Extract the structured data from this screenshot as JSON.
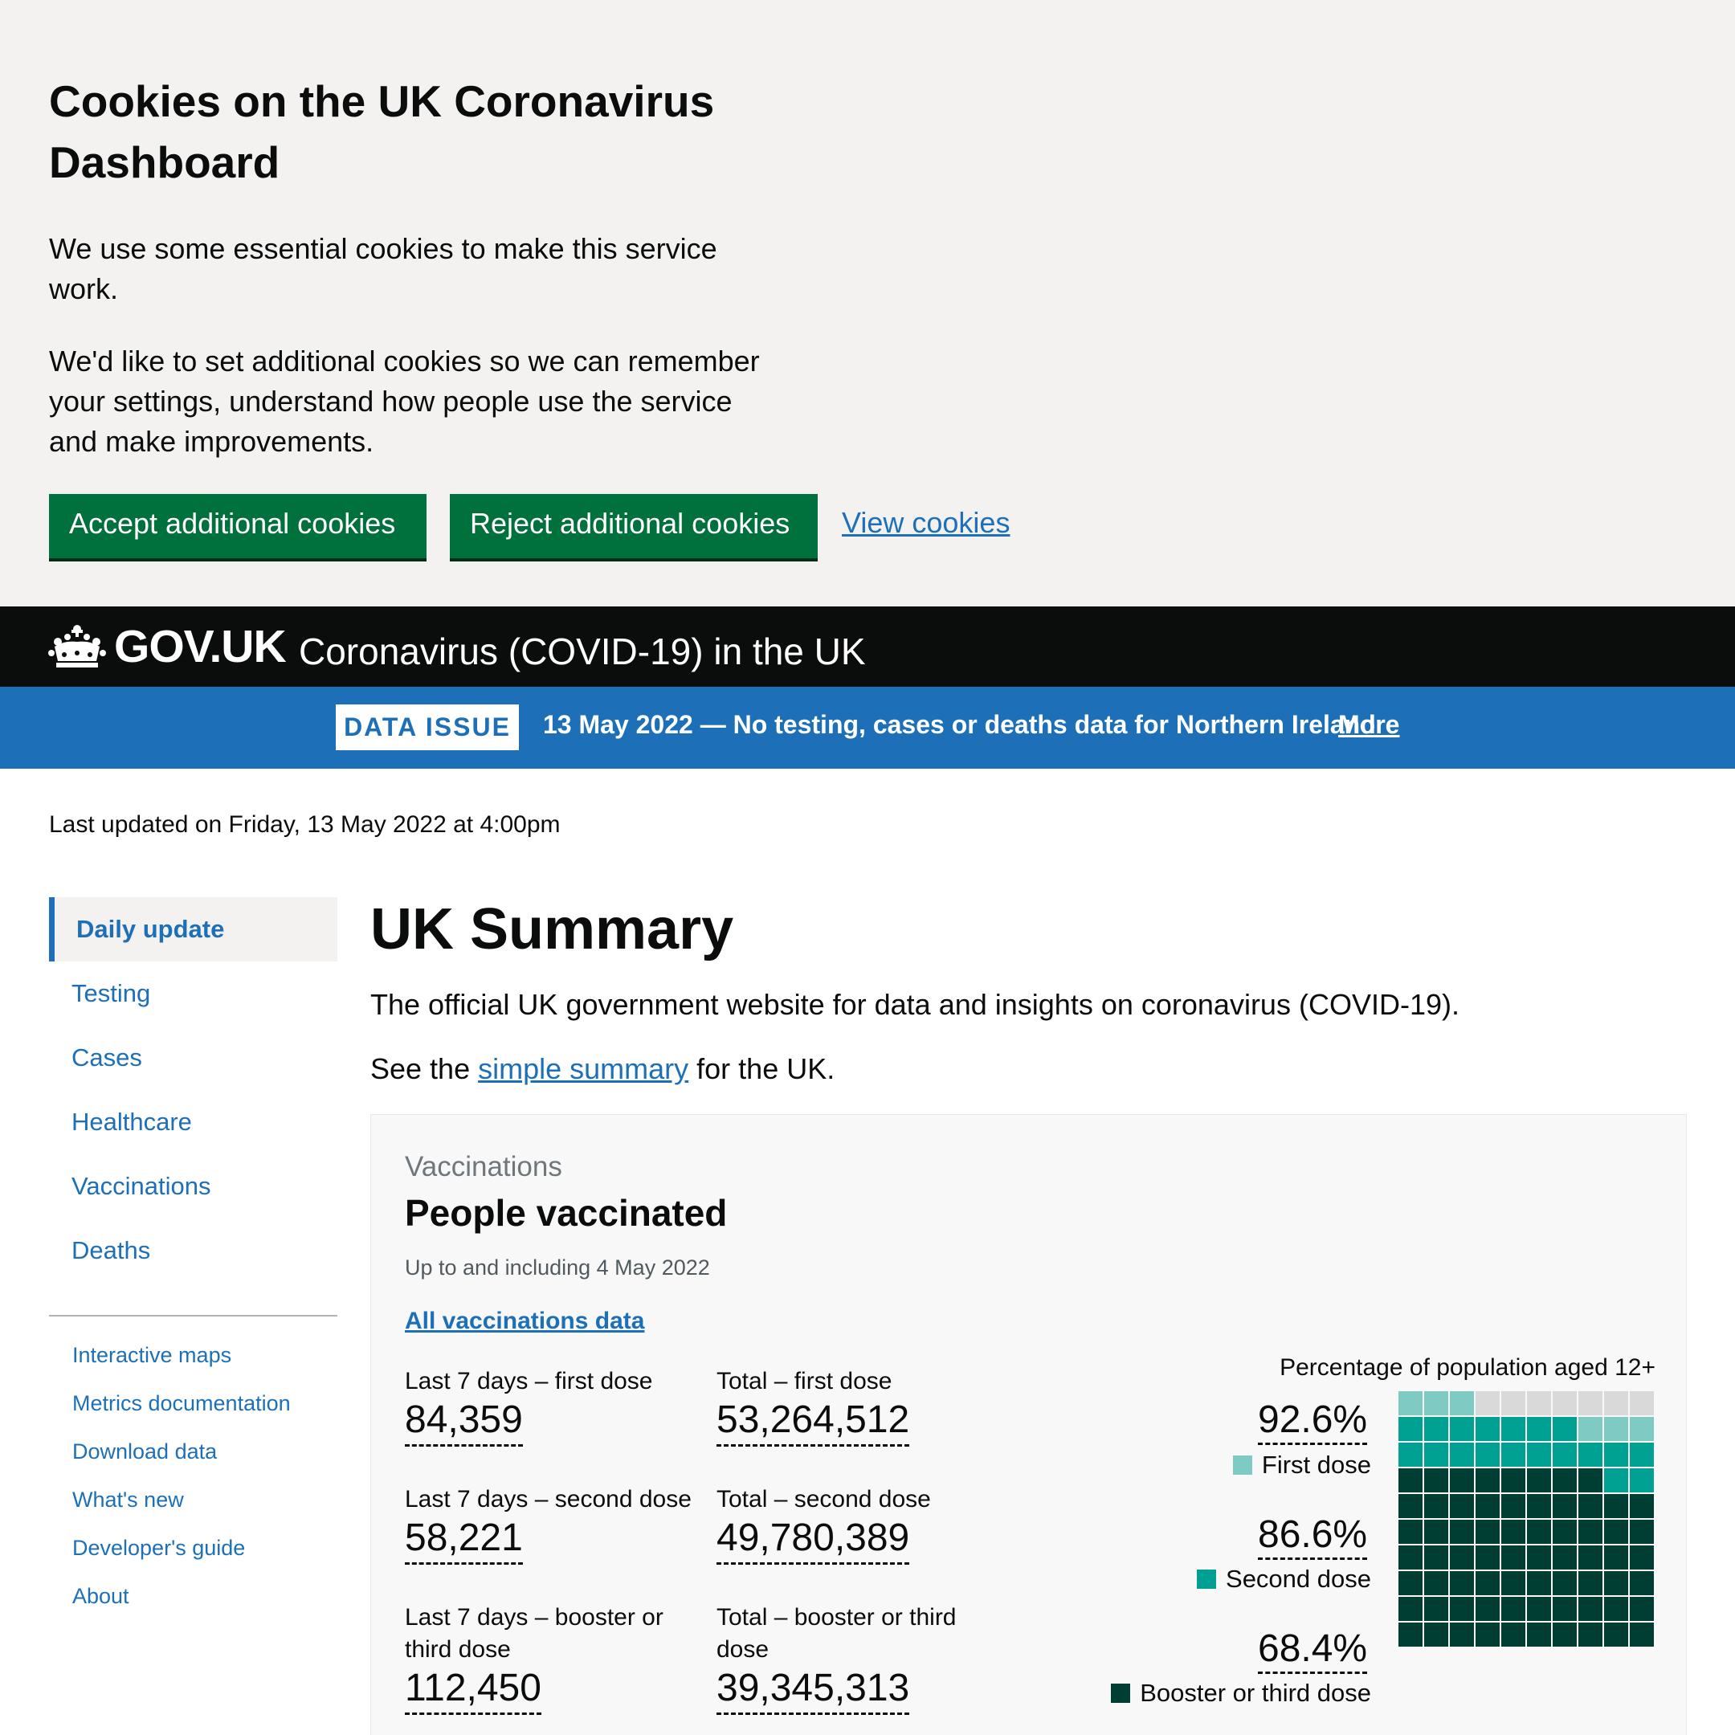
{
  "cookie_banner": {
    "title": "Cookies on the UK Coronavirus Dashboard",
    "paragraph_1": "We use some essential cookies to make this service work.",
    "paragraph_2": "We'd like to set additional cookies so we can remember your settings, understand how people use the service and make improvements.",
    "accept_label": "Accept additional cookies",
    "reject_label": "Reject additional cookies",
    "view_label": "View cookies"
  },
  "header": {
    "brand": "GOV.UK",
    "service_name": "Coronavirus (COVID-19) in the UK"
  },
  "data_issue": {
    "tag": "DATA ISSUE",
    "text": "13 May 2022 — No testing, cases or deaths data for Northern Ireland",
    "more_label": "More"
  },
  "last_updated": "Last updated on Friday, 13 May 2022 at 4:00pm",
  "sidenav": {
    "items": [
      {
        "label": "Daily update",
        "active": true
      },
      {
        "label": "Testing"
      },
      {
        "label": "Cases"
      },
      {
        "label": "Healthcare"
      },
      {
        "label": "Vaccinations"
      },
      {
        "label": "Deaths"
      }
    ],
    "secondary": [
      {
        "label": "Interactive maps"
      },
      {
        "label": "Metrics documentation"
      },
      {
        "label": "Download data"
      },
      {
        "label": "What's new"
      },
      {
        "label": "Developer's guide"
      },
      {
        "label": "About"
      }
    ]
  },
  "main": {
    "title": "UK Summary",
    "intro": "The official UK government website for data and insights on coronavirus (COVID-19).",
    "intro2_prefix": "See the ",
    "intro2_link": "simple summary",
    "intro2_suffix": " for the UK."
  },
  "vaccinations_card": {
    "category": "Vaccinations",
    "title": "People vaccinated",
    "date": "Up to and including 4 May 2022",
    "link": "All vaccinations data",
    "metrics": [
      {
        "label": "Last 7 days – first dose",
        "value": "84,359"
      },
      {
        "label": "Total – first dose",
        "value": "53,264,512"
      },
      {
        "label": "Last 7 days – second dose",
        "value": "58,221"
      },
      {
        "label": "Total – second dose",
        "value": "49,780,389"
      },
      {
        "label": "Last 7 days – booster or third dose",
        "value": "112,450"
      },
      {
        "label": "Total – booster or third dose",
        "value": "39,345,313"
      }
    ],
    "waffle": {
      "title": "Percentage of population aged 12+",
      "first_dose_pct": "92.6%",
      "first_dose_label": "First dose",
      "second_dose_pct": "86.6%",
      "second_dose_label": "Second dose",
      "booster_pct": "68.4%",
      "booster_label": "Booster or third dose",
      "values": {
        "first": 92.6,
        "second": 86.6,
        "booster": 68.4
      },
      "colors": {
        "first": "#7fcac3",
        "second": "#00a092",
        "booster": "#003d33",
        "empty": "#d9d9d9"
      }
    }
  }
}
